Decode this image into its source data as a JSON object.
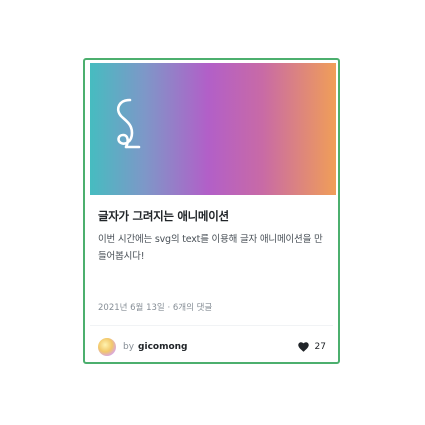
{
  "card": {
    "title": "글자가 그려지는 애니메이션",
    "description": "이번 시간에는 svg의 text를 이용해 글자 애니메이션을 만들어봅시다!",
    "date": "2021년 6월 13일",
    "separator": "·",
    "comments": "6개의 댓글",
    "by": "by",
    "username": "gicomong",
    "likes": "27"
  },
  "icons": {
    "thumbnail_glyph": "handwritten-s-outline-icon",
    "heart": "heart-icon",
    "avatar": "user-avatar"
  },
  "colors": {
    "card_border": "#4caf6e",
    "gradient": [
      "#46bcc0",
      "#b25fc8",
      "#f09e58"
    ]
  }
}
